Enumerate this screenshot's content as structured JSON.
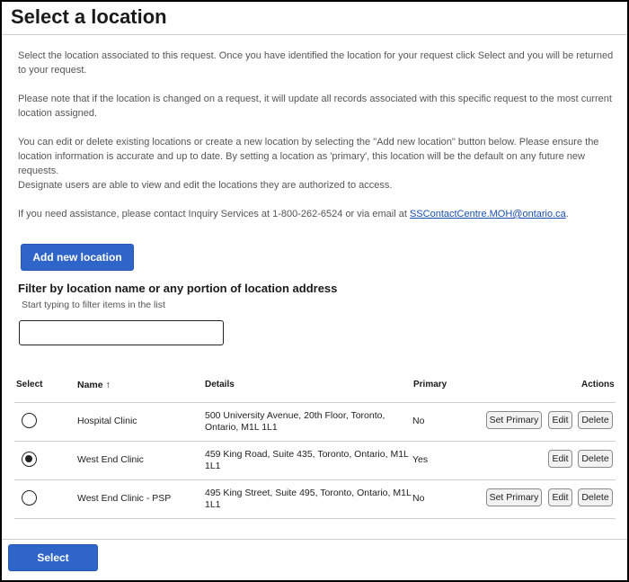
{
  "dialog": {
    "title": "Select a location"
  },
  "intro": {
    "p1": "Select the location associated to this request. Once you have identified the location for your request click Select and you will be returned to your request.",
    "p2": "Please note that if the location is changed on a request, it will update all records associated with this specific request to the most current location assigned.",
    "p3": "You can edit or delete existing locations or create a new location by selecting the \"Add new location\" button below. Please ensure the location information is accurate and up to date. By setting a location as 'primary', this location will be the default on any future new requests.",
    "p4": "Designate users are able to view and edit the locations they are authorized to access.",
    "p5_prefix": "If you need assistance, please contact Inquiry Services at 1-800-262-6524 or via email at ",
    "p5_email": "SSContactCentre.MOH@ontario.ca",
    "p5_suffix": "."
  },
  "add_button_label": "Add new location",
  "filter": {
    "heading": "Filter by location name or any portion of location address",
    "hint": "Start typing to filter items in the list",
    "value": "",
    "placeholder": ""
  },
  "table": {
    "headers": {
      "select": "Select",
      "name": "Name",
      "sort_indicator": "↑",
      "details": "Details",
      "primary": "Primary",
      "actions": "Actions"
    },
    "rows": [
      {
        "selected": false,
        "name": "Hospital Clinic",
        "details": "500 University Avenue, 20th Floor, Toronto, Ontario, M1L 1L1",
        "primary": "No",
        "set_primary_label": "Set Primary",
        "edit_label": "Edit",
        "delete_label": "Delete"
      },
      {
        "selected": true,
        "name": "West End Clinic",
        "details": "459 King Road, Suite 435, Toronto, Ontario, M1L 1L1",
        "primary": "Yes",
        "set_primary_label": "",
        "edit_label": "Edit",
        "delete_label": "Delete"
      },
      {
        "selected": false,
        "name": "West End Clinic - PSP",
        "details": "495 King Street, Suite 495, Toronto, Ontario, M1L 1L1",
        "primary": "No",
        "set_primary_label": "Set Primary",
        "edit_label": "Edit",
        "delete_label": "Delete"
      }
    ]
  },
  "footer": {
    "select_label": "Select"
  },
  "colors": {
    "primary_button": "#2f65c9",
    "link": "#1a4fb3",
    "border": "#cfcfcf"
  }
}
